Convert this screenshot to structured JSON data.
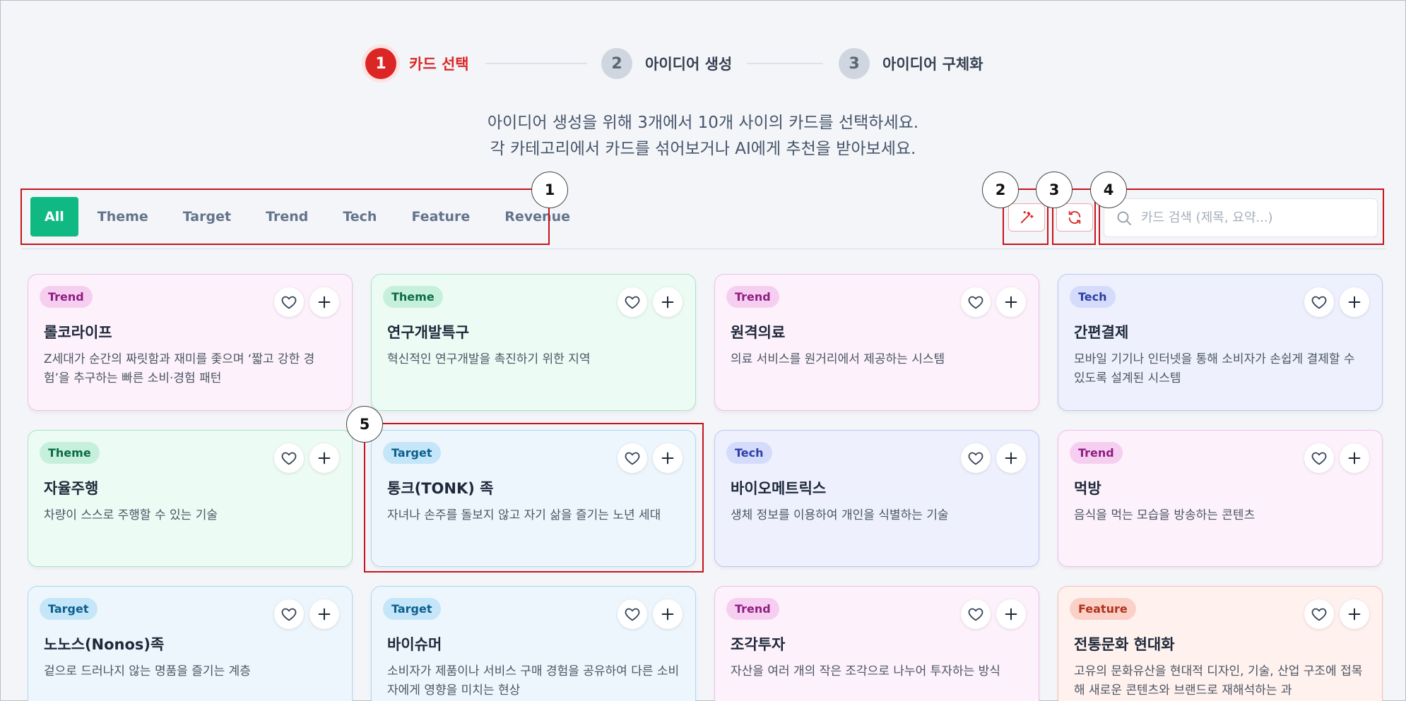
{
  "stepper": [
    {
      "num": "1",
      "label": "카드 선택",
      "active": true
    },
    {
      "num": "2",
      "label": "아이디어 생성",
      "active": false
    },
    {
      "num": "3",
      "label": "아이디어 구체화",
      "active": false
    }
  ],
  "instructions": {
    "line1": "아이디어 생성을 위해 3개에서 10개 사이의 카드를 선택하세요.",
    "line2": "각 카테고리에서 카드를 섞어보거나 AI에게 추천을 받아보세요."
  },
  "tabs": [
    "All",
    "Theme",
    "Target",
    "Trend",
    "Tech",
    "Feature",
    "Revenue"
  ],
  "active_tab": "All",
  "search": {
    "placeholder": "카드 검색 (제목, 요약...)"
  },
  "callouts": [
    "1",
    "2",
    "3",
    "4",
    "5"
  ],
  "colors": {
    "accent_green": "#10b981",
    "step_red": "#dc2626",
    "callout_red": "#c5141b"
  },
  "cards": [
    {
      "tag": "Trend",
      "title": "롤코라이프",
      "desc": "Z세대가 순간의 짜릿함과 재미를 좇으며 ‘짧고 강한 경험’을 추구하는 빠른 소비·경험 패턴"
    },
    {
      "tag": "Theme",
      "title": "연구개발특구",
      "desc": "혁신적인 연구개발을 촉진하기 위한 지역"
    },
    {
      "tag": "Trend",
      "title": "원격의료",
      "desc": "의료 서비스를 원거리에서 제공하는 시스템"
    },
    {
      "tag": "Tech",
      "title": "간편결제",
      "desc": "모바일 기기나 인터넷을 통해 소비자가 손쉽게 결제할 수 있도록 설계된 시스템"
    },
    {
      "tag": "Theme",
      "title": "자율주행",
      "desc": "차량이 스스로 주행할 수 있는 기술"
    },
    {
      "tag": "Target",
      "title": "통크(TONK) 족",
      "desc": "자녀나 손주를 돌보지 않고 자기 삶을 즐기는 노년 세대"
    },
    {
      "tag": "Tech",
      "title": "바이오메트릭스",
      "desc": "생체 정보를 이용하여 개인을 식별하는 기술"
    },
    {
      "tag": "Trend",
      "title": "먹방",
      "desc": "음식을 먹는 모습을 방송하는 콘텐츠"
    },
    {
      "tag": "Target",
      "title": "노노스(Nonos)족",
      "desc": "겉으로 드러나지 않는 명품을 즐기는 계층"
    },
    {
      "tag": "Target",
      "title": "바이슈머",
      "desc": "소비자가 제품이나 서비스 구매 경험을 공유하여 다른 소비자에게 영향을 미치는 현상"
    },
    {
      "tag": "Trend",
      "title": "조각투자",
      "desc": "자산을 여러 개의 작은 조각으로 나누어 투자하는 방식"
    },
    {
      "tag": "Feature",
      "title": "전통문화 현대화",
      "desc": "고유의 문화유산을 현대적 디자인, 기술, 산업 구조에 접목해 새로운 콘텐츠와 브랜드로 재해석하는 과"
    }
  ]
}
